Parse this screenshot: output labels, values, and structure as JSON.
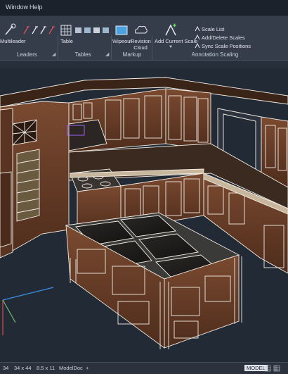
{
  "menu": {
    "window": "Window",
    "help": "Help"
  },
  "ribbon": {
    "leaders": {
      "multileader": "Multileader",
      "title": "Leaders"
    },
    "tables": {
      "table": "Table",
      "title": "Tables"
    },
    "markup": {
      "wipeout": "Wipeout",
      "revision_cloud": "Revision Cloud",
      "title": "Markup"
    },
    "annotation_scaling": {
      "add_current_scale": "Add Current Scale",
      "scale_list": "Scale List",
      "add_delete_scales": "Add/Delete Scales",
      "sync_scale_positions": "Sync Scale Positions",
      "title": "Annotation Scaling"
    }
  },
  "status_bar": {
    "tabs": [
      "34",
      "34 x 44",
      "8.5 x 11",
      "ModelDoc",
      "+"
    ],
    "model": "MODEL"
  },
  "colors": {
    "accent": "#1e90ff",
    "cabinet_line": "#f2ede4",
    "wood": "#6b3f2a",
    "background": "#1f2633"
  }
}
